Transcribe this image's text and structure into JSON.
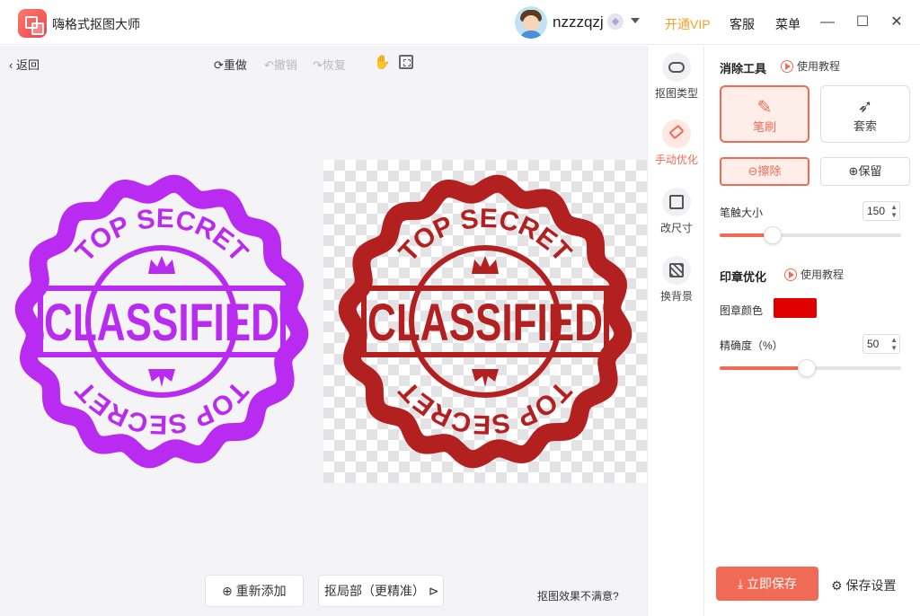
{
  "app": {
    "title": "嗨格式抠图大师",
    "username": "nzzzqzj"
  },
  "topbar": {
    "vip": "开通VIP",
    "service": "客服",
    "menu": "菜单"
  },
  "window": {
    "minimize": "—",
    "maximize": "☐",
    "close": "✕"
  },
  "toolbar": {
    "back": "返回",
    "redo": "重做",
    "undo": "撤销",
    "restore": "恢复"
  },
  "stamp": {
    "top_text": "TOP SECRET",
    "main_text": "CLASSIFIED",
    "bottom_text": "TOP SECRET",
    "left_color": "#b92bf0",
    "right_color": "#b32020"
  },
  "bottom": {
    "readd": "重新添加",
    "partial": "抠局部（更精准）",
    "unhappy": "抠图效果不满意?"
  },
  "strip": {
    "items": [
      {
        "label": "抠图类型",
        "icon": "cutout-type-icon"
      },
      {
        "label": "手动优化",
        "icon": "eraser-icon"
      },
      {
        "label": "改尺寸",
        "icon": "resize-icon"
      },
      {
        "label": "换背景",
        "icon": "background-icon"
      }
    ]
  },
  "panel": {
    "erase_title": "消除工具",
    "help": "使用教程",
    "brush": "笔刷",
    "lasso": "套索",
    "erase": "擦除",
    "keep": "保留",
    "brush_size_label": "笔触大小",
    "brush_size": "150",
    "brush_size_fraction": 0.29,
    "seal_title": "印章优化",
    "seal_color_label": "图章颜色",
    "seal_color": "#e00000",
    "precision_label": "精确度（%）",
    "precision": "50",
    "precision_fraction": 0.48,
    "save_now": "立即保存",
    "save_settings": "保存设置"
  },
  "colors": {
    "accent": "#f06a55",
    "vip": "#f3a224"
  }
}
